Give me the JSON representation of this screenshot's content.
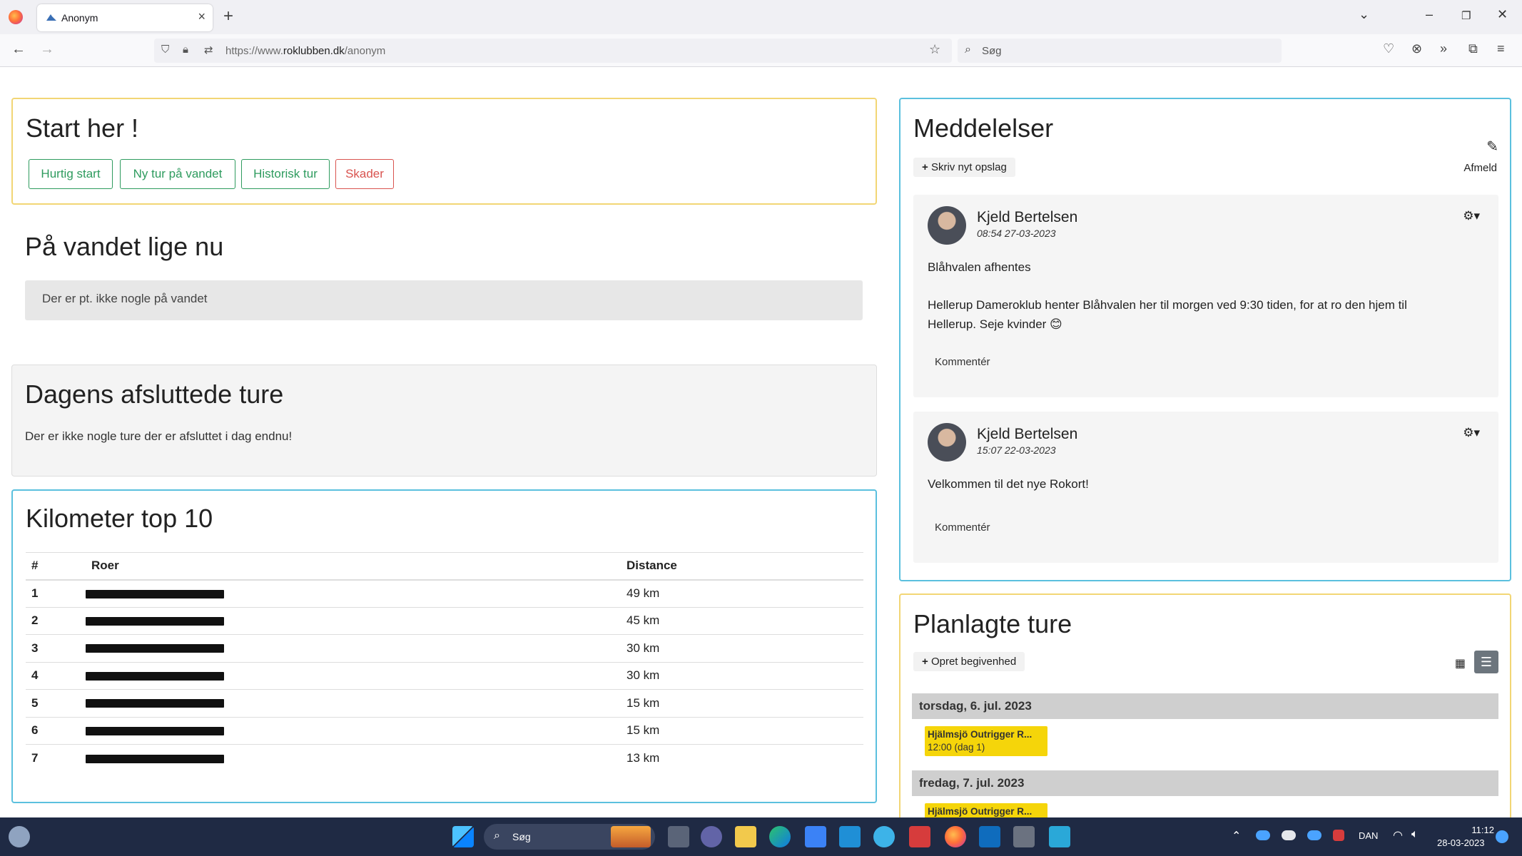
{
  "browser": {
    "tab_title": "Anonym",
    "url_prefix": "https://www.",
    "url_domain": "roklubben.dk",
    "url_path": "/anonym",
    "search_placeholder": "Søg"
  },
  "start": {
    "title": "Start her !",
    "buttons": [
      "Hurtig start",
      "Ny tur på vandet",
      "Historisk tur",
      "Skader"
    ]
  },
  "on_water": {
    "title": "På vandet lige nu",
    "empty_text": "Der er pt. ikke nogle på vandet"
  },
  "finished": {
    "title": "Dagens afsluttede ture",
    "empty_text": "Der er ikke nogle ture der er afsluttet i dag endnu!"
  },
  "km_top": {
    "title": "Kilometer top 10",
    "headers": [
      "#",
      "Roer",
      "Distance"
    ],
    "rows": [
      {
        "rank": "1",
        "distance": "49 km"
      },
      {
        "rank": "2",
        "distance": "45 km"
      },
      {
        "rank": "3",
        "distance": "30 km"
      },
      {
        "rank": "4",
        "distance": "30 km"
      },
      {
        "rank": "5",
        "distance": "15 km"
      },
      {
        "rank": "6",
        "distance": "15 km"
      },
      {
        "rank": "7",
        "distance": "13 km"
      }
    ]
  },
  "messages": {
    "title": "Meddelelser",
    "new_post": "Skriv nyt opslag",
    "unsubscribe": "Afmeld",
    "comment_label": "Kommentér",
    "posts": [
      {
        "author": "Kjeld Bertelsen",
        "date": "08:54 27-03-2023",
        "lines": [
          "Blåhvalen afhentes",
          "Hellerup Dameroklub henter Blåhvalen her til morgen ved 9:30 tiden, for at ro den hjem til",
          "Hellerup. Seje kvinder 😊"
        ]
      },
      {
        "author": "Kjeld Bertelsen",
        "date": "15:07 22-03-2023",
        "lines": [
          "Velkommen til det nye Rokort!"
        ]
      }
    ]
  },
  "planned": {
    "title": "Planlagte ture",
    "create_event": "Opret begivenhed",
    "days": [
      {
        "label": "torsdag, 6. jul. 2023",
        "event_title": "Hjälmsjö Outrigger R...",
        "event_time": "12:00 (dag 1)"
      },
      {
        "label": "fredag, 7. jul. 2023",
        "event_title": "Hjälmsjö Outrigger R...",
        "event_time": ""
      }
    ]
  },
  "taskbar": {
    "search_label": "Søg",
    "lang": "DAN",
    "time": "11:12",
    "date": "28-03-2023"
  }
}
